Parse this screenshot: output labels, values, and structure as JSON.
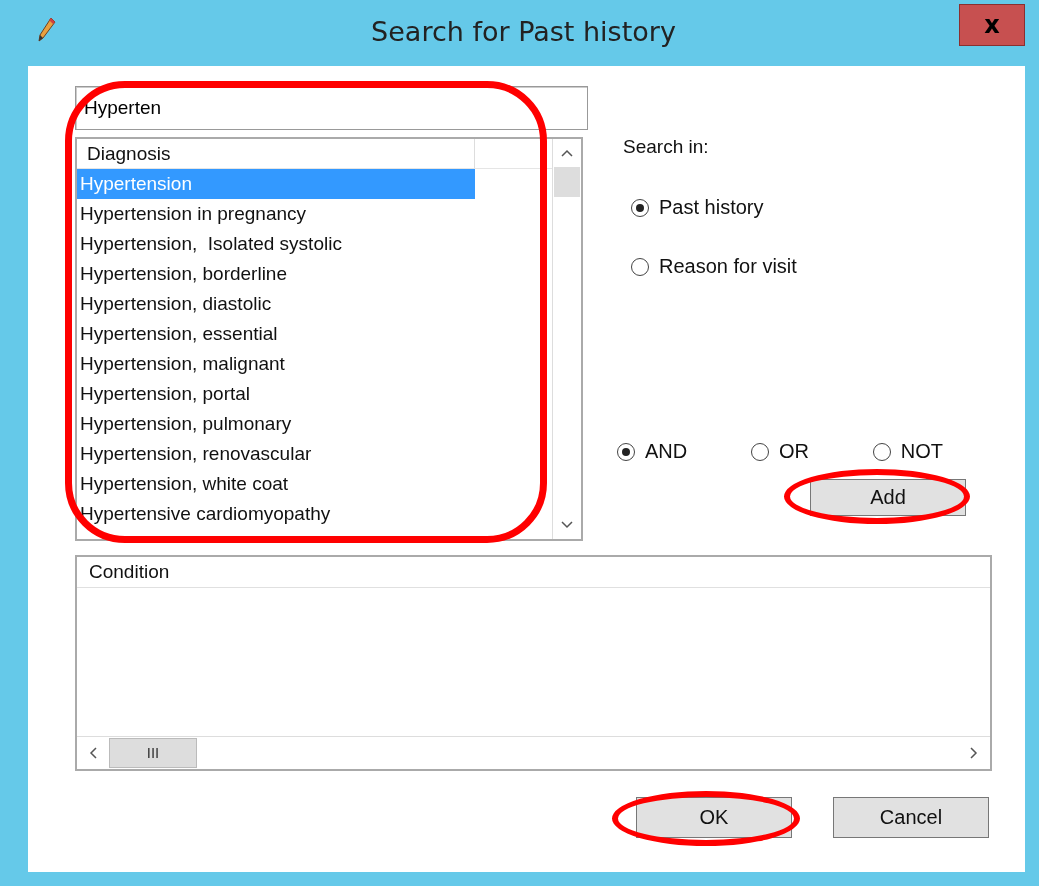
{
  "window": {
    "title": "Search for Past history",
    "close_label": "x"
  },
  "search": {
    "value": "Hyperten"
  },
  "results": {
    "column": "Diagnosis",
    "highlighted": true,
    "items": [
      {
        "label": "Hypertension",
        "selected": true
      },
      {
        "label": "Hypertension in pregnancy",
        "selected": false
      },
      {
        "label": "Hypertension,  Isolated systolic",
        "selected": false
      },
      {
        "label": "Hypertension, borderline",
        "selected": false
      },
      {
        "label": "Hypertension, diastolic",
        "selected": false
      },
      {
        "label": "Hypertension, essential",
        "selected": false
      },
      {
        "label": "Hypertension, malignant",
        "selected": false
      },
      {
        "label": "Hypertension, portal",
        "selected": false
      },
      {
        "label": "Hypertension, pulmonary",
        "selected": false
      },
      {
        "label": "Hypertension, renovascular",
        "selected": false
      },
      {
        "label": "Hypertension, white coat",
        "selected": false
      },
      {
        "label": "Hypertensive cardiomyopathy",
        "selected": false
      }
    ]
  },
  "search_in": {
    "label": "Search in:",
    "options": [
      {
        "label": "Past history",
        "selected": true
      },
      {
        "label": "Reason for visit",
        "selected": false
      }
    ]
  },
  "operators": [
    {
      "label": "AND",
      "selected": true
    },
    {
      "label": "OR",
      "selected": false
    },
    {
      "label": "NOT",
      "selected": false
    }
  ],
  "add_button": {
    "label": "Add",
    "highlighted": true
  },
  "conditions": {
    "column": "Condition",
    "scroll_thumb": "III"
  },
  "buttons": [
    {
      "label": "OK",
      "highlighted": true
    },
    {
      "label": "Cancel",
      "highlighted": false
    }
  ]
}
